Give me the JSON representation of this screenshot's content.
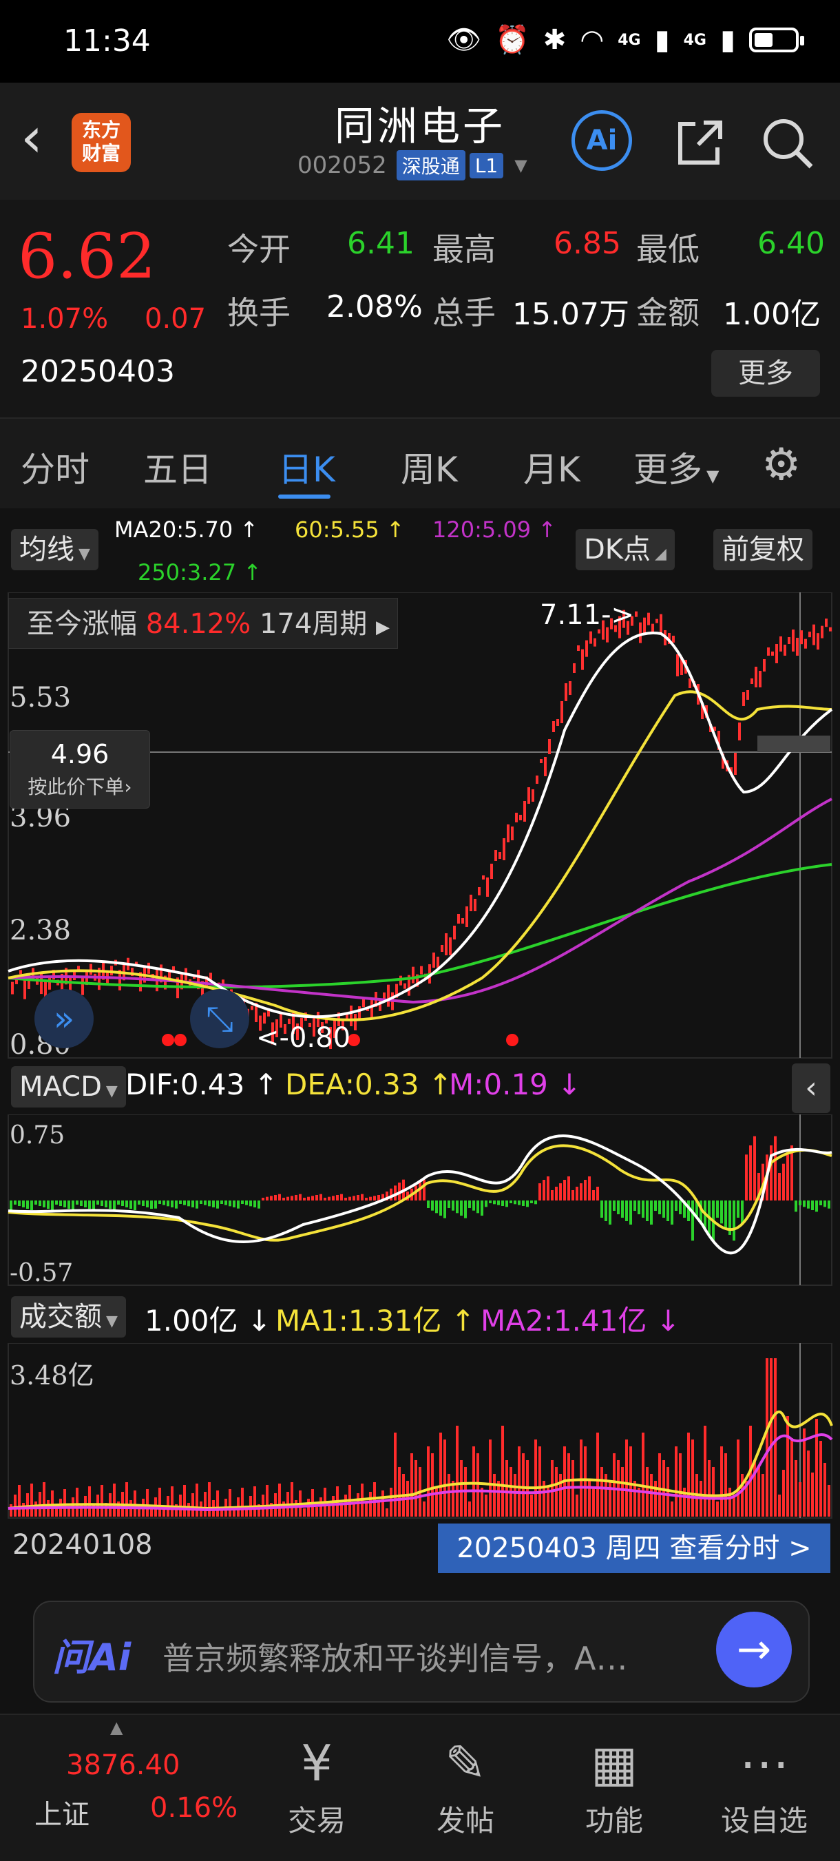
{
  "status_bar": {
    "time": "11:34",
    "net1": "4G",
    "net2": "4G"
  },
  "header": {
    "logo_line1": "东方",
    "logo_line2": "财富",
    "stock_name": "同洲电子",
    "code": "002052",
    "tag_sgt": "深股通",
    "tag_level": "L1",
    "ai_label": "Ai"
  },
  "quote": {
    "price": "6.62",
    "pct": "1.07%",
    "change": "0.07",
    "date": "20250403",
    "open_label": "今开",
    "open": "6.41",
    "high_label": "最高",
    "high": "6.85",
    "low_label": "最低",
    "low": "6.40",
    "turnover_label": "换手",
    "turnover": "2.08%",
    "volume_label": "总手",
    "volume": "15.07万",
    "amount_label": "金额",
    "amount": "1.00亿",
    "more_label": "更多"
  },
  "tabs": {
    "t1": "分时",
    "t2": "五日",
    "t3": "日K",
    "t4": "周K",
    "t5": "月K",
    "t6": "更多"
  },
  "ma_row": {
    "chip": "均线",
    "ma20": "MA20:5.70",
    "ma60": "60:5.55",
    "ma120": "120:5.09",
    "ma250": "250:3.27",
    "dk": "DK点",
    "fq": "前复权"
  },
  "kchart": {
    "range_label": "至今涨幅",
    "range_pct": "84.12%",
    "range_periods": "174周期",
    "y_labels": [
      "5.53",
      "3.96",
      "2.38",
      "0.80"
    ],
    "high_marker": "7.11->",
    "low_marker": "<-0.80",
    "price_tag_value": "4.96",
    "price_tag_label": "按此价下单"
  },
  "macd": {
    "chip": "MACD",
    "dif": "DIF:0.43",
    "dea": "DEA:0.33",
    "m": "M:0.19",
    "y_top": "0.75",
    "y_bottom": "-0.57"
  },
  "volume": {
    "chip": "成交额",
    "value": "1.00亿",
    "ma1": "MA1:1.31亿",
    "ma2": "MA2:1.41亿",
    "y_top": "3.48亿"
  },
  "chart_footer": {
    "start_date": "20240108",
    "view_btn": "20250403 周四 查看分时 >"
  },
  "ai_bar": {
    "logo": "问Ai",
    "text": "普京频繁释放和平谈判信号，A…"
  },
  "bottom_nav": {
    "index_value": "3876.40",
    "index_name": "上证",
    "index_pct": "0.16%",
    "trade": "交易",
    "post": "发帖",
    "func": "功能",
    "watch": "设自选"
  },
  "colors": {
    "up": "#ff2b2b",
    "down": "#2bd22b",
    "accent": "#3c8ef0",
    "ma20": "#ffffff",
    "ma60": "#f4e23a",
    "ma120": "#c233c8",
    "ma250": "#2bd22b"
  }
}
